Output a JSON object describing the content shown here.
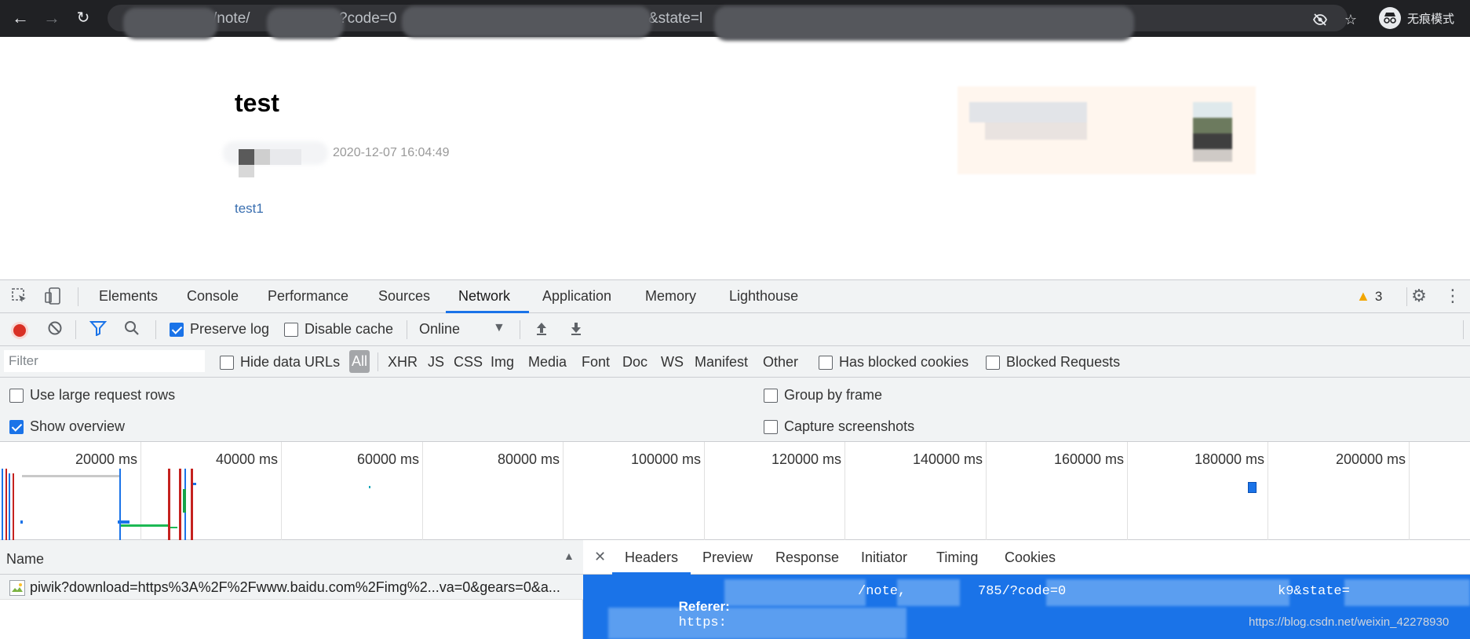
{
  "browser": {
    "url_segments": [
      "/note/",
      "?code=0",
      "&state=l"
    ],
    "incognito_label": "无痕模式"
  },
  "page": {
    "title": "test",
    "date": "2020-12-07 16:04:49",
    "link_text": "test1"
  },
  "devtools": {
    "tabs": [
      "Elements",
      "Console",
      "Performance",
      "Sources",
      "Network",
      "Application",
      "Memory",
      "Lighthouse"
    ],
    "active_tab": "Network",
    "warning_count": "3",
    "toolbar": {
      "preserve_log": "Preserve log",
      "disable_cache": "Disable cache",
      "throttling": "Online"
    },
    "filter": {
      "placeholder": "Filter",
      "hide_data_urls": "Hide data URLs",
      "types": [
        "All",
        "XHR",
        "JS",
        "CSS",
        "Img",
        "Media",
        "Font",
        "Doc",
        "WS",
        "Manifest",
        "Other"
      ],
      "has_blocked_cookies": "Has blocked cookies",
      "blocked_requests": "Blocked Requests"
    },
    "settings": {
      "large_rows": "Use large request rows",
      "show_overview": "Show overview",
      "group_by_frame": "Group by frame",
      "capture_screenshots": "Capture screenshots"
    },
    "overview_ticks": [
      "20000 ms",
      "40000 ms",
      "60000 ms",
      "80000 ms",
      "100000 ms",
      "120000 ms",
      "140000 ms",
      "160000 ms",
      "180000 ms",
      "200000 ms"
    ],
    "request_list": {
      "column_name": "Name",
      "rows": [
        "piwik?download=https%3A%2F%2Fwww.baidu.com%2Fimg%2...va=0&gears=0&a..."
      ]
    },
    "detail": {
      "tabs": [
        "Headers",
        "Preview",
        "Response",
        "Initiator",
        "Timing",
        "Cookies"
      ],
      "active_tab": "Headers",
      "header_key": "Referer:",
      "header_value_parts": [
        "https:",
        "/note,",
        "785/?code=0",
        "k9&state="
      ]
    },
    "watermark": "https://blog.csdn.net/weixin_42278930"
  },
  "colors": {
    "accent": "#1a73e8",
    "record": "#d93025",
    "warning": "#f2a600"
  }
}
